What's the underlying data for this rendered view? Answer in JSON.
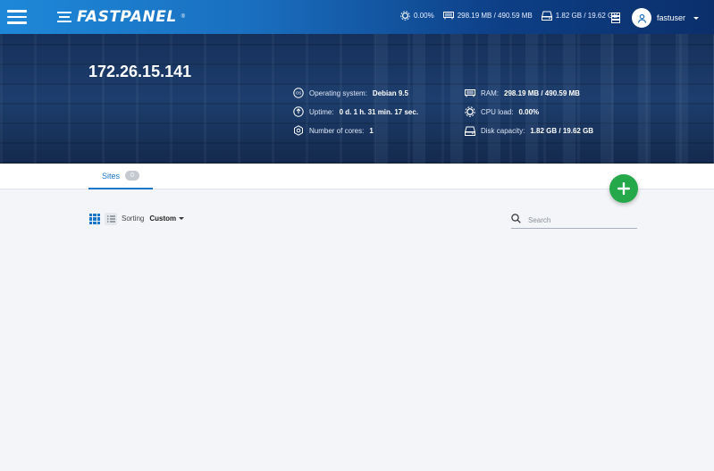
{
  "header": {
    "brand": "FASTPANEL",
    "brand_mark": "®",
    "stats": {
      "cpu": "0.00%",
      "ram": "298.19 MB / 490.59 MB",
      "disk": "1.82 GB / 19.62 GB"
    },
    "user": "fastuser"
  },
  "hero": {
    "ip": "172.26.15.141",
    "os_label": "Operating system:",
    "os_value": "Debian 9.5",
    "uptime_label": "Uptime:",
    "uptime_value": "0 d. 1 h. 31 min. 17 sec.",
    "cores_label": "Number of cores:",
    "cores_value": "1",
    "ram_label": "RAM:",
    "ram_value": "298.19 MB / 490.59 MB",
    "cpu_label": "CPU load:",
    "cpu_value": "0.00%",
    "disk_label": "Disk capacity:",
    "disk_value": "1.82 GB / 19.62 GB"
  },
  "tabs": {
    "sites_label": "Sites",
    "sites_count": "0"
  },
  "toolbar": {
    "sorting_label": "Sorting",
    "sorting_value": "Custom",
    "search_placeholder": "Search"
  },
  "colors": {
    "accent": "#1a76c9",
    "fab": "#25a84a",
    "topbar_start": "#1e88d8",
    "topbar_end": "#0b2f6b"
  }
}
